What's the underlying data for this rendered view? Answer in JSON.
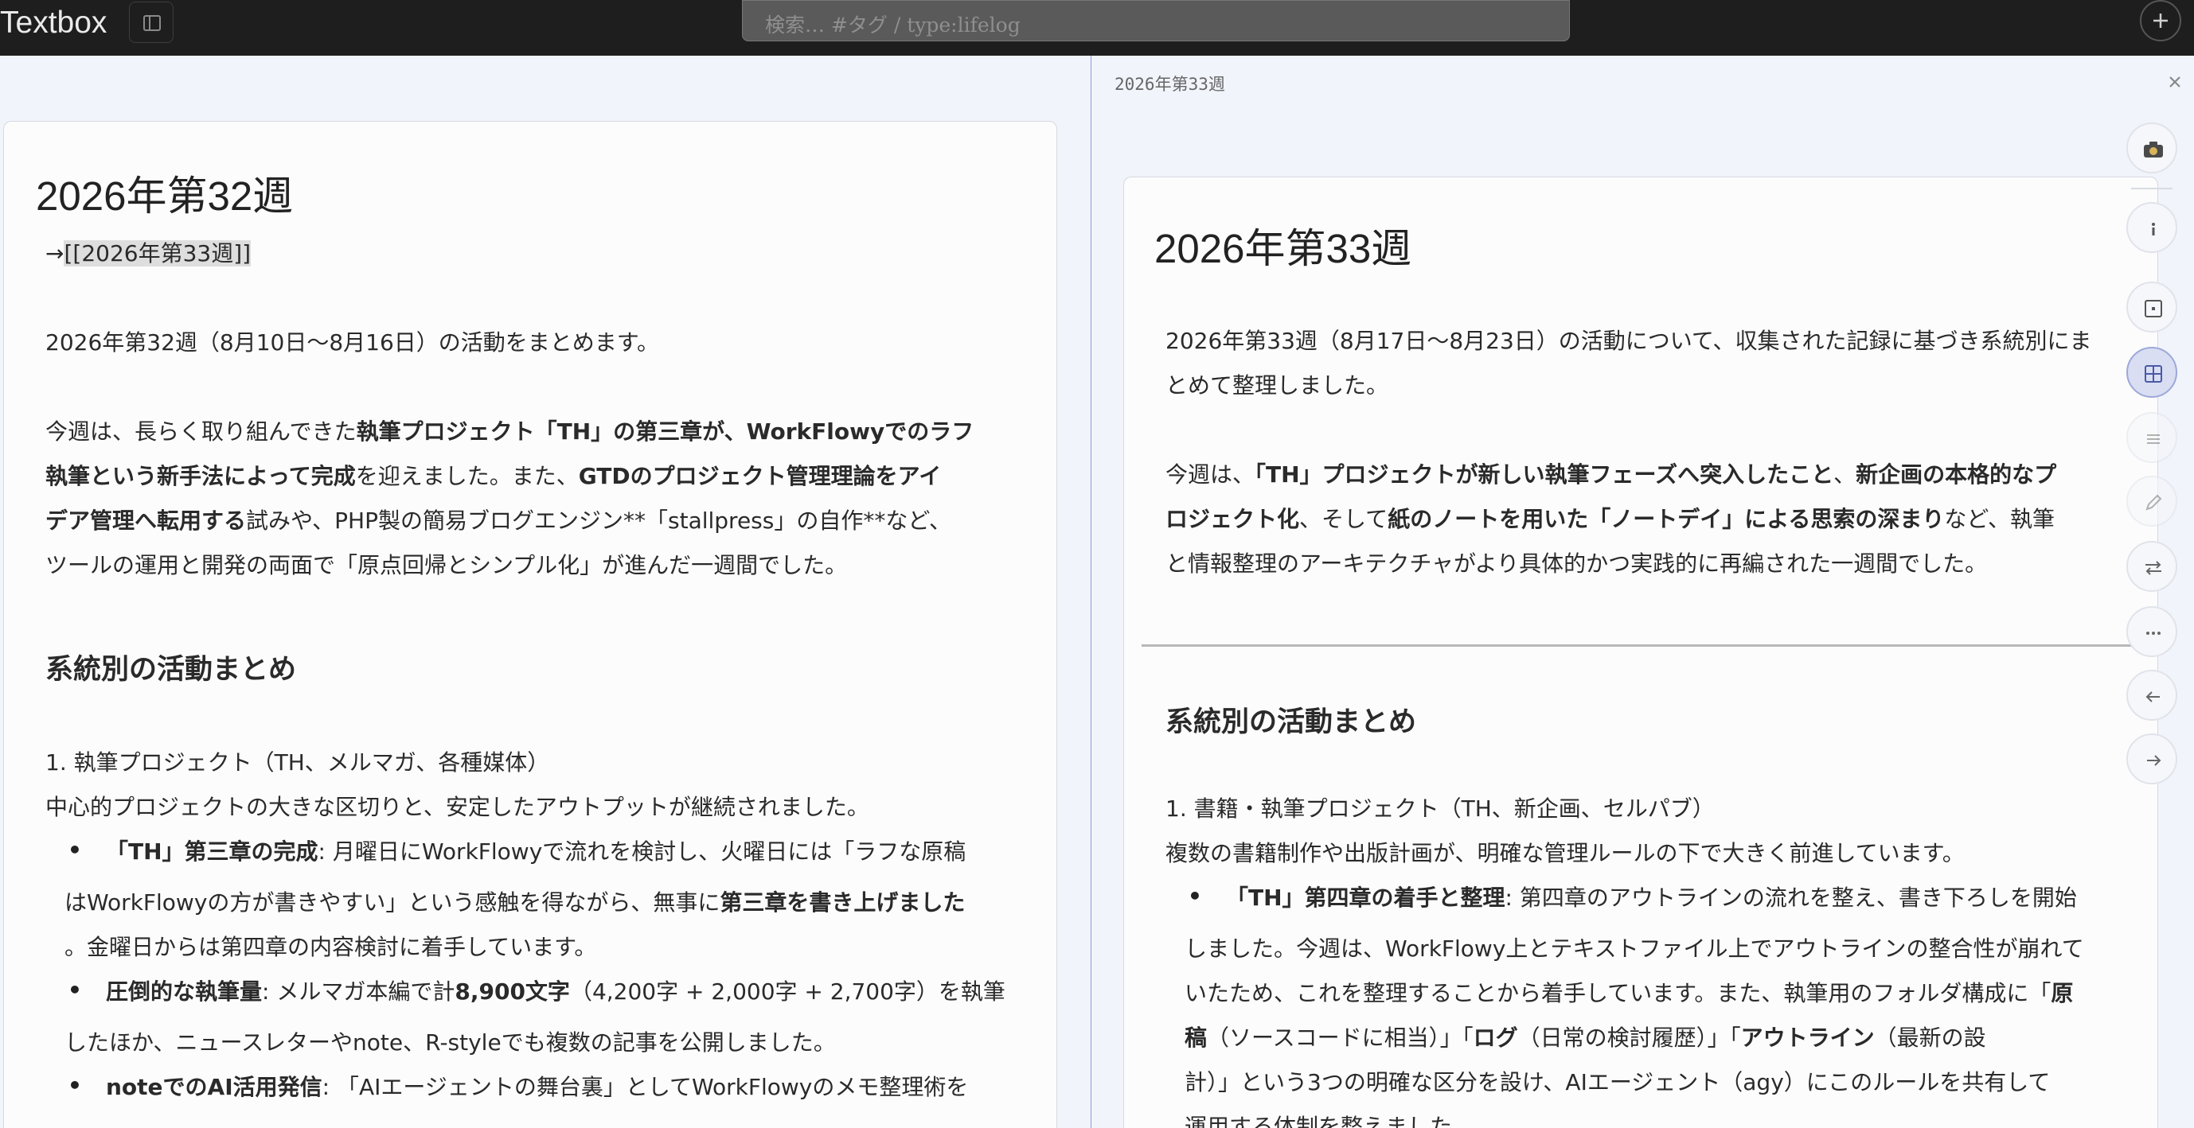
{
  "app": {
    "title": "Textbox",
    "search_placeholder": "検索… #タグ / type:lifelog"
  },
  "left_doc": {
    "title": "2026年第32週",
    "link_prefix": "→",
    "link_text": "[[2026年第33週]]",
    "intro": "2026年第32週（8月10日〜8月16日）の活動をまとめます。",
    "summary": {
      "l1": [
        "今週は、長らく取り組んできた",
        "執筆プロジェクト「TH」の第三章が、WorkFlowyでのラフ"
      ],
      "l2": [
        "執筆という新手法によって完成",
        "を迎えました。また、",
        "GTDのプロジェクト管理理論をアイ"
      ],
      "l3": [
        "デア管理へ転用する",
        "試みや、PHP製の簡易ブログエンジン**「stallpress」の自作**など、"
      ],
      "l4": "ツールの運用と開発の両面で「原点回帰とシンプル化」が進んだ一週間でした。"
    },
    "section_heading": "系統別の活動まとめ",
    "item1_heading": "1. 執筆プロジェクト（TH、メルマガ、各種媒体）",
    "item1_desc": "中心的プロジェクトの大きな区切りと、安定したアウトプットが継続されました。",
    "bullet_char": "•",
    "b1": {
      "l1": [
        "「TH」第三章の完成",
        ": 月曜日にWorkFlowyで流れを検討し、火曜日には「ラフな原稿"
      ],
      "l2": [
        "はWorkFlowyの方が書きやすい」という感触を得ながら、無事に",
        "第三章を書き上げました"
      ],
      "l3": "。金曜日からは第四章の内容検討に着手しています。"
    },
    "b2": {
      "l1": [
        "圧倒的な執筆量",
        ": メルマガ本編で計",
        "8,900文字",
        "（4,200字 + 2,000字 + 2,700字）を執筆"
      ],
      "l2": "したほか、ニュースレターやnote、R-styleでも複数の記事を公開しました。"
    },
    "b3": {
      "l1": [
        "noteでのAI活用発信",
        ": 「AIエージェントの舞台裏」としてWorkFlowyのメモ整理術を"
      ]
    }
  },
  "right_doc": {
    "header_title": "2026年第33週",
    "title": "2026年第33週",
    "intro_l1": "2026年第33週（8月17日〜8月23日）の活動について、収集された記録に基づき系統別にま",
    "intro_l2": "とめて整理しました。",
    "summary": {
      "l1": [
        "今週は、",
        "「TH」プロジェクトが新しい執筆フェーズへ突入したこと",
        "、",
        "新企画の本格的なプ"
      ],
      "l2": [
        "ロジェクト化",
        "、そして",
        "紙のノートを用いた「ノートデイ」による思索の深まり",
        "など、執筆"
      ],
      "l3": "と情報整理のアーキテクチャがより具体的かつ実践的に再編された一週間でした。"
    },
    "section_heading": "系統別の活動まとめ",
    "item1_heading": "1. 書籍・執筆プロジェクト（TH、新企画、セルパブ）",
    "item1_desc": "複数の書籍制作や出版計画が、明確な管理ルールの下で大きく前進しています。",
    "b1": {
      "l1": [
        "「TH」第四章の着手と整理",
        ": 第四章のアウトラインの流れを整え、書き下ろしを開始"
      ],
      "l2": "しました。今週は、WorkFlowy上とテキストファイル上でアウトラインの整合性が崩れて",
      "l3": [
        "いたため、これを整理することから着手しています。また、執筆用のフォルダ構成に「",
        "原"
      ],
      "l4": [
        "稿",
        "（ソースコードに相当）」「",
        "ログ",
        "（日常の検討履歴）」「",
        "アウトライン",
        "（最新の設"
      ],
      "l5": "計）」という3つの明確な区分を設け、AIエージェント（agy）にこのルールを共有して",
      "l6": "運用する体制を整えました。"
    }
  },
  "toolbar": {
    "icons": [
      "camera-icon",
      "info-icon",
      "focus-icon",
      "grid-icon",
      "list-icon",
      "edit-icon",
      "swap-icon",
      "more-icon",
      "back-icon",
      "forward-icon"
    ]
  }
}
